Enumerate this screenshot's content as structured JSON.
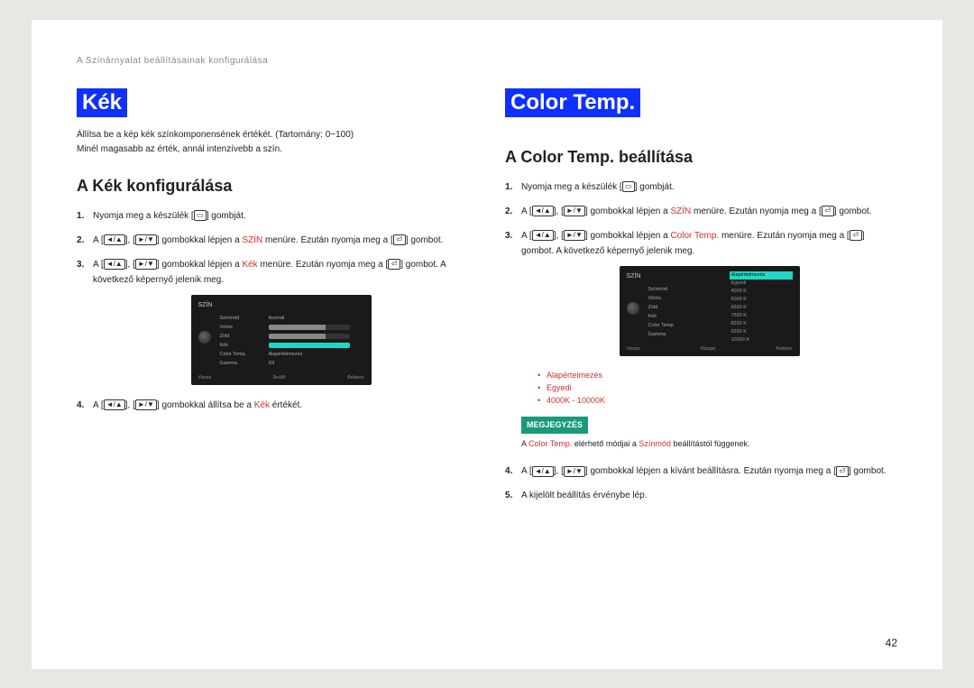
{
  "breadcrumb": "A Színárnyalat beállításainak konfigurálása",
  "left": {
    "tag": "Kék",
    "desc1": "Állítsa be a kép kék színkomponensének értékét. (Tartomány: 0~100)",
    "desc2": "Minél magasabb az érték, annál intenzívebb a szín.",
    "subheading": "A Kék konfigurálása",
    "step1_a": "Nyomja meg a készülék [",
    "step1_b": "] gombját.",
    "step2_a": "A [",
    "step2_b": "], [",
    "step2_c": "] gombokkal lépjen a ",
    "step2_red": "SZÍN",
    "step2_d": " menüre. Ezután nyomja meg a [",
    "step2_e": "] gombot.",
    "step3_a": "A [",
    "step3_b": "], [",
    "step3_c": "] gombokkal lépjen a ",
    "step3_red": "Kék",
    "step3_d": " menüre. Ezután nyomja meg a [",
    "step3_e": "] gombot. A következő képernyő jelenik meg.",
    "step4_a": "A [",
    "step4_b": "], [",
    "step4_c": "] gombokkal állítsa be a ",
    "step4_red": "Kék",
    "step4_d": " értékét.",
    "osd": {
      "title": "SZÍN",
      "rows": [
        "Színmód",
        "Vörös",
        "Zöld",
        "Kék",
        "Color Temp.",
        "Gamma"
      ],
      "normal": "Normál",
      "reset": "Alapértelmezés",
      "x9": "X9",
      "footer": [
        "Vissza",
        "Beállít",
        "Belépés"
      ]
    }
  },
  "right": {
    "tag": "Color Temp.",
    "subheading": "A Color Temp. beállítása",
    "step1_a": "Nyomja meg a készülék [",
    "step1_b": "] gombját.",
    "step2_a": "A [",
    "step2_b": "], [",
    "step2_c": "] gombokkal lépjen a ",
    "step2_red": "SZÍN",
    "step2_d": " menüre. Ezután nyomja meg a [",
    "step2_e": "] gombot.",
    "step3_a": "A [",
    "step3_b": "], [",
    "step3_c": "] gombokkal lépjen a ",
    "step3_red": "Color Temp.",
    "step3_d": " menüre. Ezután nyomja meg a [",
    "step3_e": "] gombot. A következő képernyő jelenik meg.",
    "osd": {
      "title": "SZÍN",
      "rows": [
        "Színmód",
        "Vörös",
        "Zöld",
        "Kék",
        "Color Temp.",
        "Gamma"
      ],
      "list": [
        "Alapértelmezés",
        "Egyedi",
        "4000 K",
        "5000 K",
        "6500 K",
        "7500 K",
        "8200 K",
        "9300 K",
        "10000 K"
      ],
      "footer": [
        "Vissza",
        "Mozgat",
        "Belépés"
      ]
    },
    "bullets": [
      "Alapértelmezés",
      "Egyedi",
      "4000K - 10000K"
    ],
    "note_tag": "MEGJEGYZÉS",
    "note_a": "A ",
    "note_red1": "Color Temp.",
    "note_b": " elérhető módjai a ",
    "note_red2": "Színmód",
    "note_c": " beállítástól függenek.",
    "step4_a": "A [",
    "step4_b": "], [",
    "step4_c": "] gombokkal lépjen a kívánt beállításra. Ezután nyomja meg a [",
    "step4_d": "] gombot.",
    "step5": "A kijelölt beállítás érvénybe lép."
  },
  "page_num": "42",
  "icons": {
    "menu": "▭",
    "updown1": "◄/▲",
    "updown2": "►/▼",
    "enter": "⏎"
  }
}
